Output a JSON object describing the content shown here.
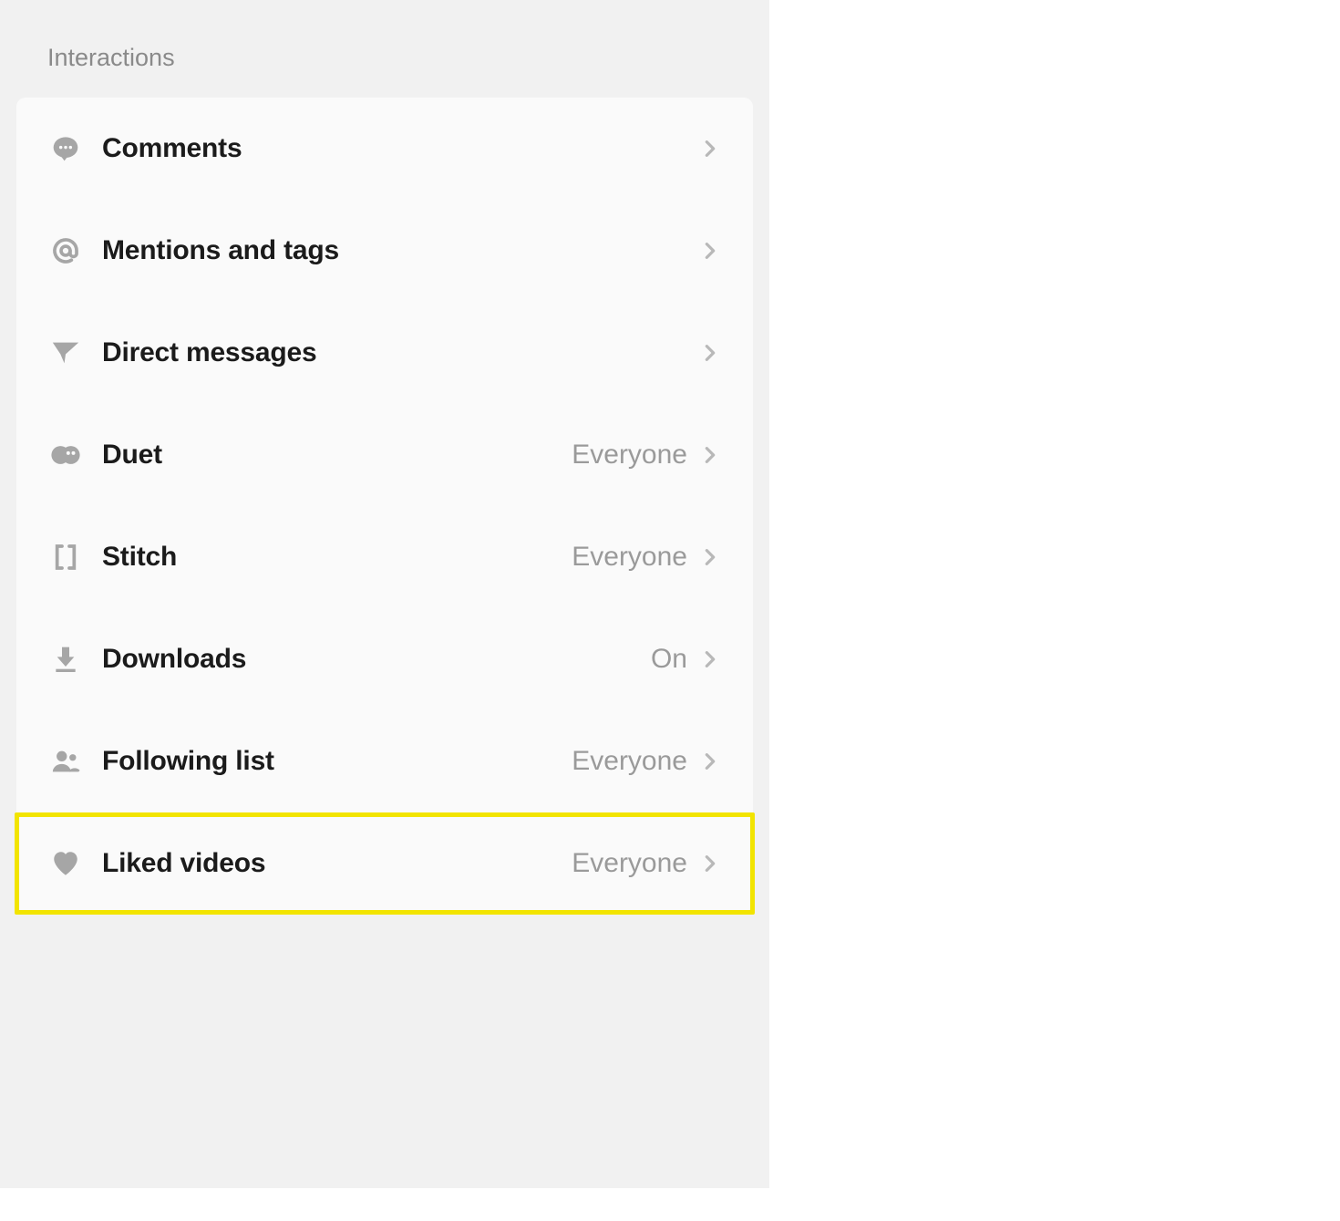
{
  "section": {
    "title": "Interactions",
    "items": [
      {
        "label": "Comments",
        "value": "",
        "icon": "comment-icon",
        "highlighted": false
      },
      {
        "label": "Mentions and tags",
        "value": "",
        "icon": "at-icon",
        "highlighted": false
      },
      {
        "label": "Direct messages",
        "value": "",
        "icon": "send-icon",
        "highlighted": false
      },
      {
        "label": "Duet",
        "value": "Everyone",
        "icon": "duet-icon",
        "highlighted": false
      },
      {
        "label": "Stitch",
        "value": "Everyone",
        "icon": "stitch-icon",
        "highlighted": false
      },
      {
        "label": "Downloads",
        "value": "On",
        "icon": "download-icon",
        "highlighted": false
      },
      {
        "label": "Following list",
        "value": "Everyone",
        "icon": "people-icon",
        "highlighted": false
      },
      {
        "label": "Liked videos",
        "value": "Everyone",
        "icon": "heart-icon",
        "highlighted": true
      }
    ]
  },
  "colors": {
    "iconGray": "#a6a6a6",
    "chevronGray": "#b8b8b8",
    "highlightBorder": "#f2e400"
  }
}
